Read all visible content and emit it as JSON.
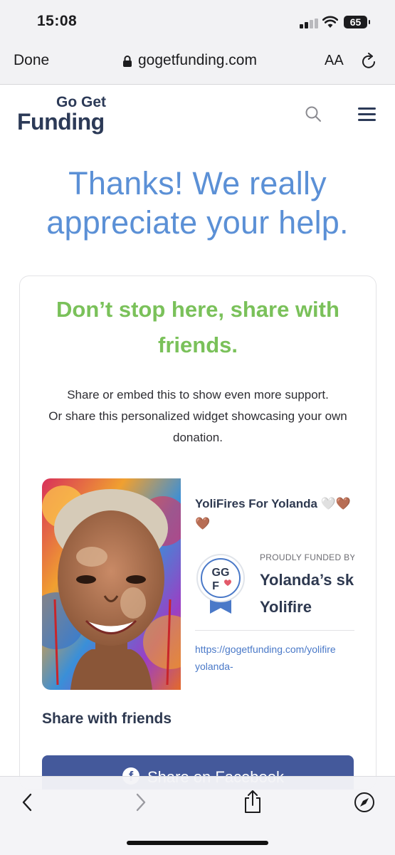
{
  "status": {
    "time": "15:08",
    "battery": "65"
  },
  "browser": {
    "done_label": "Done",
    "domain": "gogetfunding.com",
    "text_size_label": "AA"
  },
  "site": {
    "logo_line1": "Go Get",
    "logo_line2": "Funding"
  },
  "hero": {
    "line1": "Thanks! We really",
    "line2": "appreciate your help."
  },
  "card": {
    "heading_line1": "Don’t stop here, share with",
    "heading_line2": "friends.",
    "desc_line1": "Share or embed this to show even more support.",
    "desc_line2": "Or share this personalized widget showcasing your own",
    "desc_line3": "donation."
  },
  "widget": {
    "campaign_title": "YoliFires For Yolanda 🤍🤎🤎",
    "badge_letters_top": "GG",
    "badge_letters_bottom": "F",
    "proudly_funded": "PROUDLY FUNDED BY",
    "fund_name_line1": "Yolanda’s ski",
    "fund_name_line2": "Yolifire",
    "url_line1": "https://gogetfunding.com/yolifire",
    "url_line2": "yolanda-"
  },
  "share": {
    "heading": "Share with friends",
    "facebook_label": "Share on Facebook"
  },
  "colors": {
    "accent_blue": "#5b90d6",
    "accent_green": "#7ac15a",
    "navy": "#2c3a57",
    "facebook": "#44599b",
    "link": "#4a79c8"
  },
  "icons": [
    "lock-icon",
    "reload-icon",
    "search-icon",
    "menu-icon",
    "facebook-icon",
    "back-icon",
    "forward-icon",
    "share-icon",
    "compass-icon"
  ]
}
